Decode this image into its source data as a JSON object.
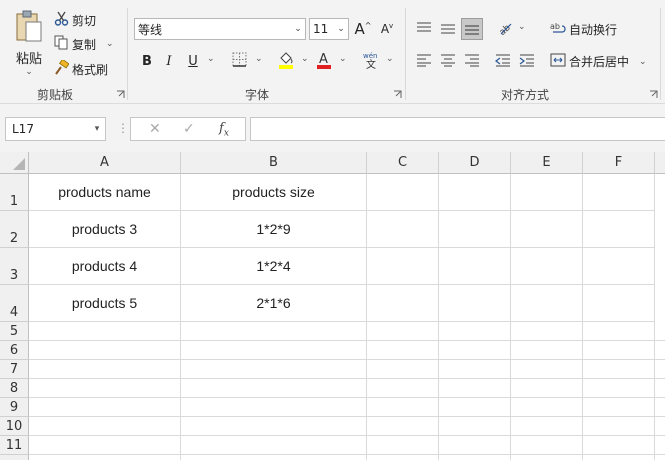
{
  "ribbon": {
    "clipboard": {
      "paste_label": "粘贴",
      "cut_label": "剪切",
      "copy_label": "复制",
      "format_painter_label": "格式刷",
      "group_label": "剪贴板"
    },
    "font": {
      "font_name": "等线",
      "font_size": "11",
      "bold": "B",
      "italic": "I",
      "underline": "U",
      "group_label": "字体",
      "highlight_color": "#ffff00",
      "font_color": "#e02020"
    },
    "alignment": {
      "wrap_text_label": "自动换行",
      "merge_center_label": "合并后居中",
      "group_label": "对齐方式"
    }
  },
  "formula_bar": {
    "name_box": "L17",
    "formula": ""
  },
  "sheet": {
    "columns": [
      "A",
      "B",
      "C",
      "D",
      "E",
      "F"
    ],
    "rows": [
      "1",
      "2",
      "3",
      "4",
      "5",
      "6",
      "7",
      "8",
      "9",
      "10",
      "11"
    ],
    "cells": {
      "A1": "products name",
      "B1": "products size",
      "A2": "products 3",
      "B2": "1*2*9",
      "A3": "products 4",
      "B3": "1*2*4",
      "A4": "products 5",
      "B4": "2*1*6"
    }
  }
}
